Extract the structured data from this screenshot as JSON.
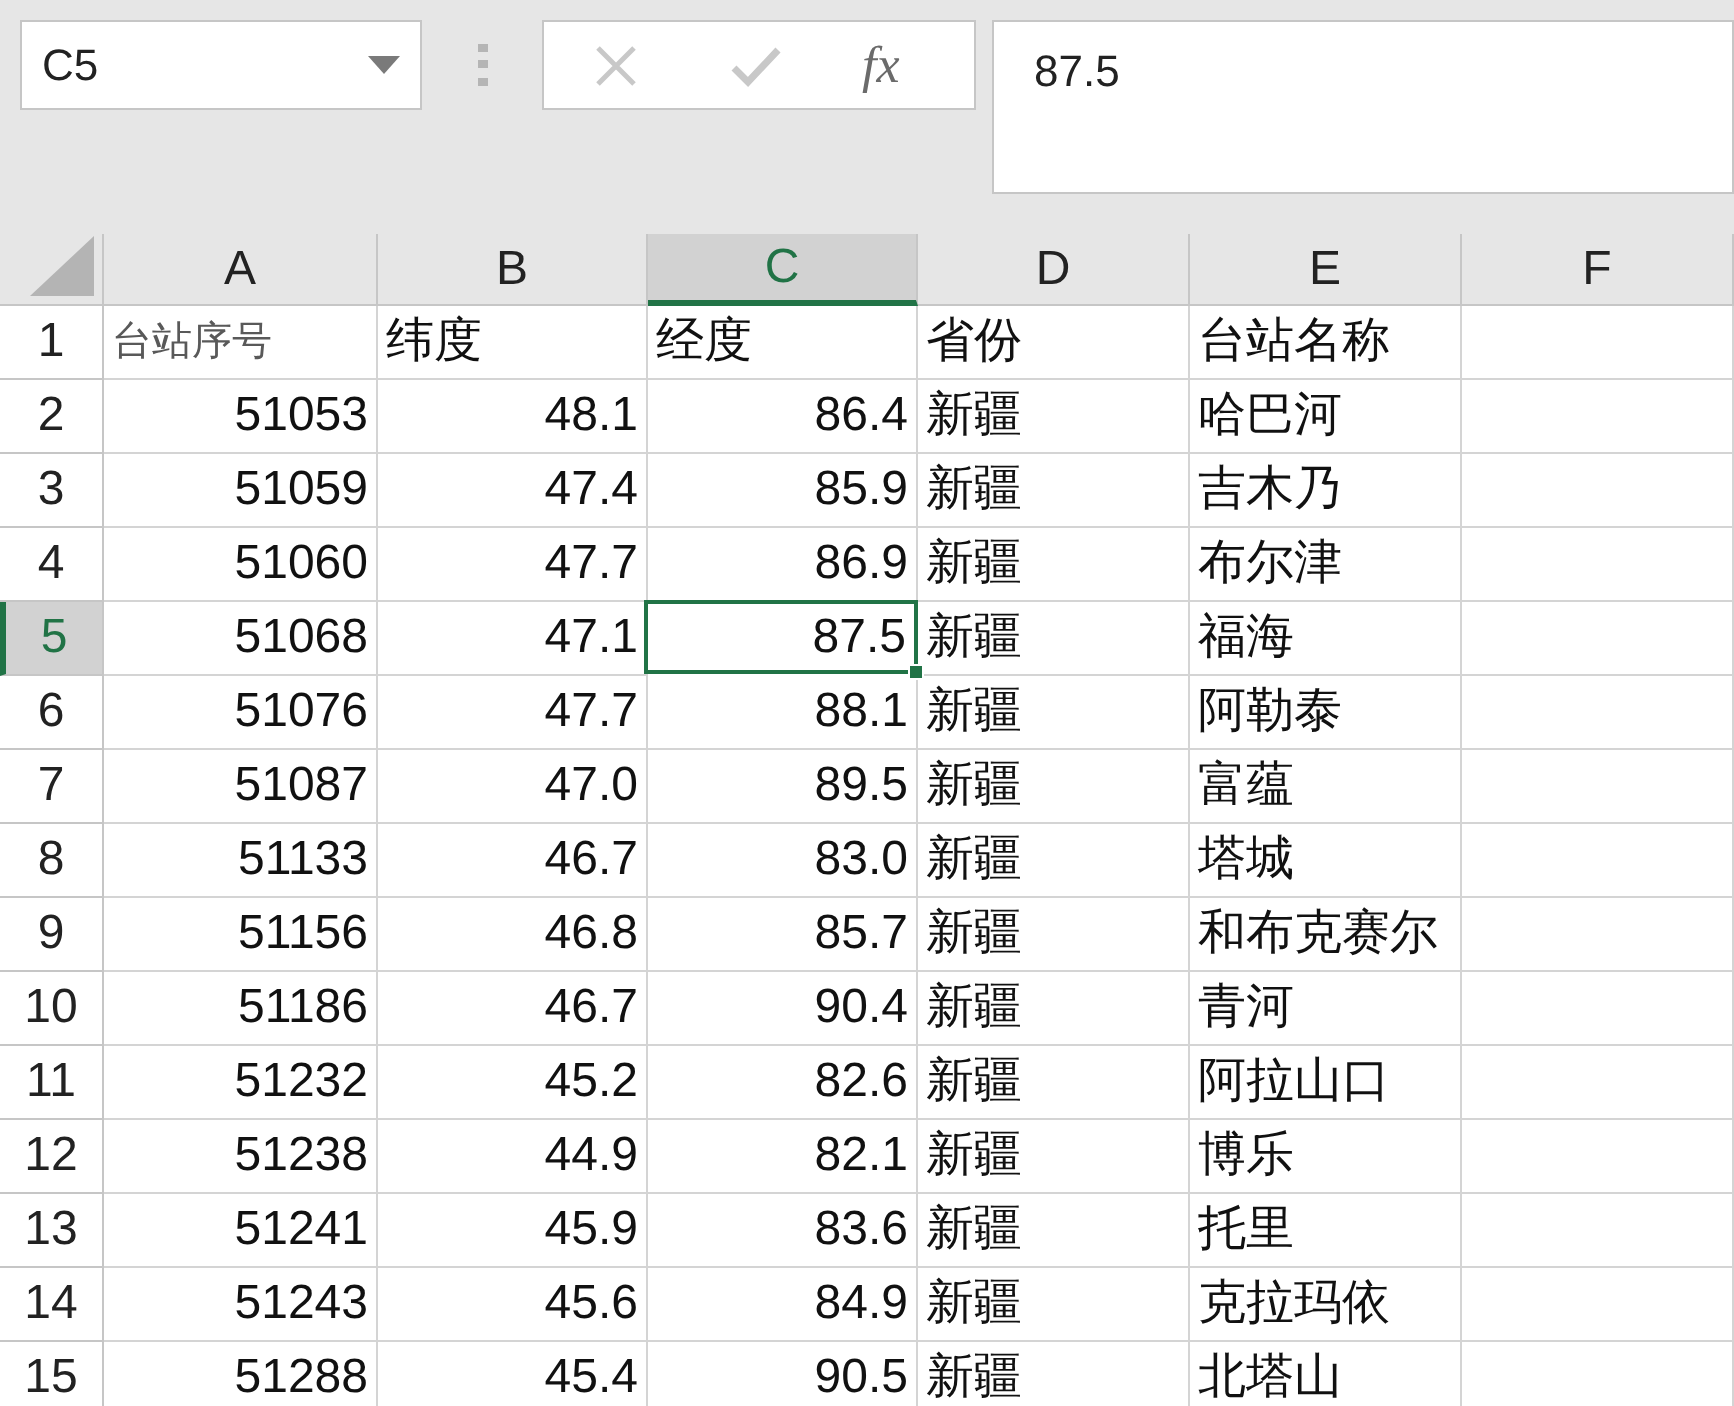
{
  "name_box": {
    "value": "C5"
  },
  "formula_bar": {
    "function_label": "fx",
    "value": "87.5"
  },
  "columns": [
    {
      "label": "A",
      "selected": false,
      "kind": "number"
    },
    {
      "label": "B",
      "selected": false,
      "kind": "number"
    },
    {
      "label": "C",
      "selected": true,
      "kind": "number"
    },
    {
      "label": "D",
      "selected": false,
      "kind": "text"
    },
    {
      "label": "E",
      "selected": false,
      "kind": "text"
    },
    {
      "label": "F",
      "selected": false,
      "kind": "text"
    }
  ],
  "rows": [
    {
      "header": "1",
      "selected": false,
      "kind": "header",
      "cells": [
        "台站序号",
        "纬度",
        "经度",
        "省份",
        "台站名称"
      ]
    },
    {
      "header": "2",
      "selected": false,
      "kind": "data",
      "cells": [
        "51053",
        "48.1",
        "86.4",
        "新疆",
        "哈巴河"
      ]
    },
    {
      "header": "3",
      "selected": false,
      "kind": "data",
      "cells": [
        "51059",
        "47.4",
        "85.9",
        "新疆",
        "吉木乃"
      ]
    },
    {
      "header": "4",
      "selected": false,
      "kind": "data",
      "cells": [
        "51060",
        "47.7",
        "86.9",
        "新疆",
        "布尔津"
      ]
    },
    {
      "header": "5",
      "selected": true,
      "kind": "data",
      "cells": [
        "51068",
        "47.1",
        "87.5",
        "新疆",
        "福海"
      ]
    },
    {
      "header": "6",
      "selected": false,
      "kind": "data",
      "cells": [
        "51076",
        "47.7",
        "88.1",
        "新疆",
        "阿勒泰"
      ]
    },
    {
      "header": "7",
      "selected": false,
      "kind": "data",
      "cells": [
        "51087",
        "47.0",
        "89.5",
        "新疆",
        "富蕴"
      ]
    },
    {
      "header": "8",
      "selected": false,
      "kind": "data",
      "cells": [
        "51133",
        "46.7",
        "83.0",
        "新疆",
        "塔城"
      ]
    },
    {
      "header": "9",
      "selected": false,
      "kind": "data",
      "cells": [
        "51156",
        "46.8",
        "85.7",
        "新疆",
        "和布克赛尔"
      ]
    },
    {
      "header": "10",
      "selected": false,
      "kind": "data",
      "cells": [
        "51186",
        "46.7",
        "90.4",
        "新疆",
        "青河"
      ]
    },
    {
      "header": "11",
      "selected": false,
      "kind": "data",
      "cells": [
        "51232",
        "45.2",
        "82.6",
        "新疆",
        "阿拉山口"
      ]
    },
    {
      "header": "12",
      "selected": false,
      "kind": "data",
      "cells": [
        "51238",
        "44.9",
        "82.1",
        "新疆",
        "博乐"
      ]
    },
    {
      "header": "13",
      "selected": false,
      "kind": "data",
      "cells": [
        "51241",
        "45.9",
        "83.6",
        "新疆",
        "托里"
      ]
    },
    {
      "header": "14",
      "selected": false,
      "kind": "data",
      "cells": [
        "51243",
        "45.6",
        "84.9",
        "新疆",
        "克拉玛依"
      ]
    },
    {
      "header": "15",
      "selected": false,
      "kind": "data",
      "cells": [
        "51288",
        "45.4",
        "90.5",
        "新疆",
        "北塔山"
      ]
    }
  ]
}
